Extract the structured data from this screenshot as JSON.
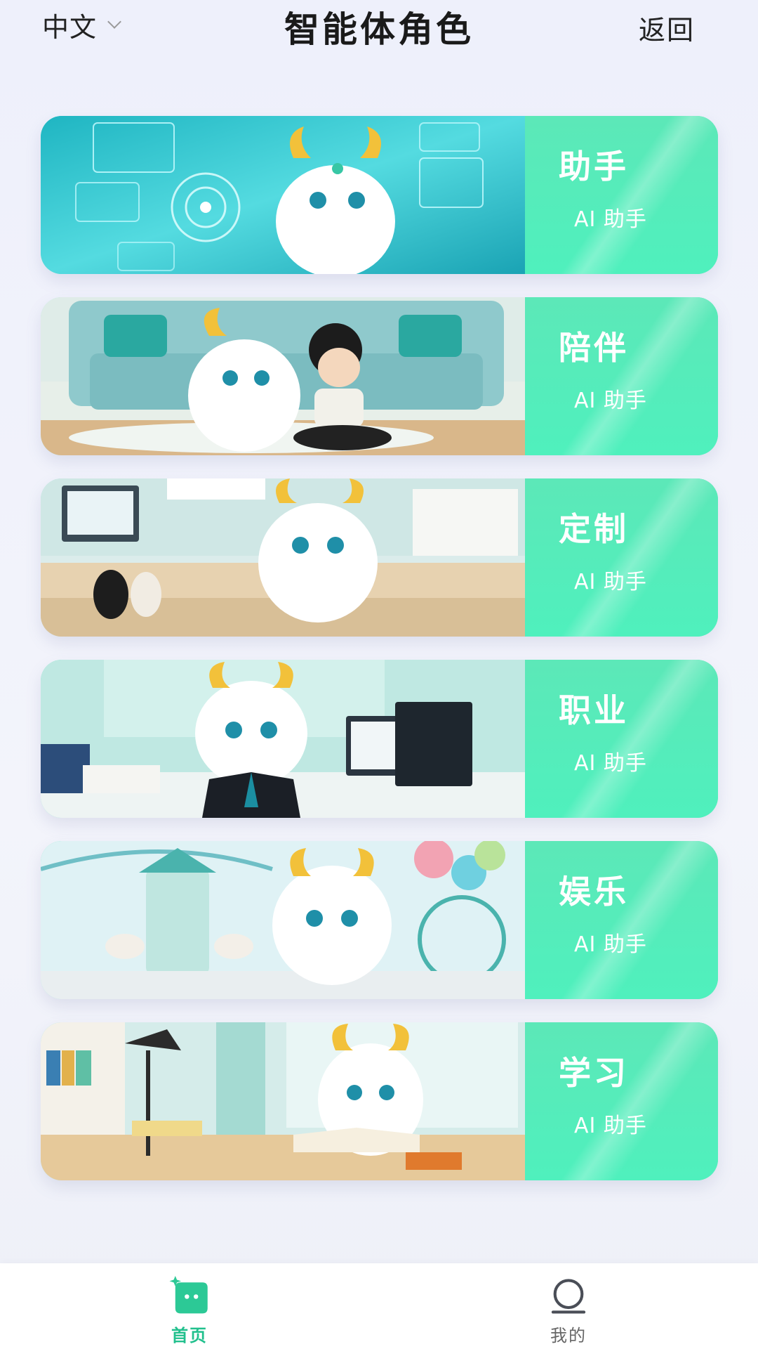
{
  "header": {
    "language": "中文",
    "title": "智能体角色",
    "back_label": "返回"
  },
  "cards": [
    {
      "title": "助手",
      "subtitle": "AI 助手",
      "scene": "tech"
    },
    {
      "title": "陪伴",
      "subtitle": "AI 助手",
      "scene": "living-room"
    },
    {
      "title": "定制",
      "subtitle": "AI 助手",
      "scene": "workshop"
    },
    {
      "title": "职业",
      "subtitle": "AI 助手",
      "scene": "office"
    },
    {
      "title": "娱乐",
      "subtitle": "AI 助手",
      "scene": "amusement-park"
    },
    {
      "title": "学习",
      "subtitle": "AI 助手",
      "scene": "study"
    }
  ],
  "bottom_nav": {
    "home_label": "首页",
    "mine_label": "我的",
    "active": "home"
  },
  "colors": {
    "accent": "#4ff0bd",
    "nav_active": "#21c08d",
    "background": "#f1f2fa"
  }
}
